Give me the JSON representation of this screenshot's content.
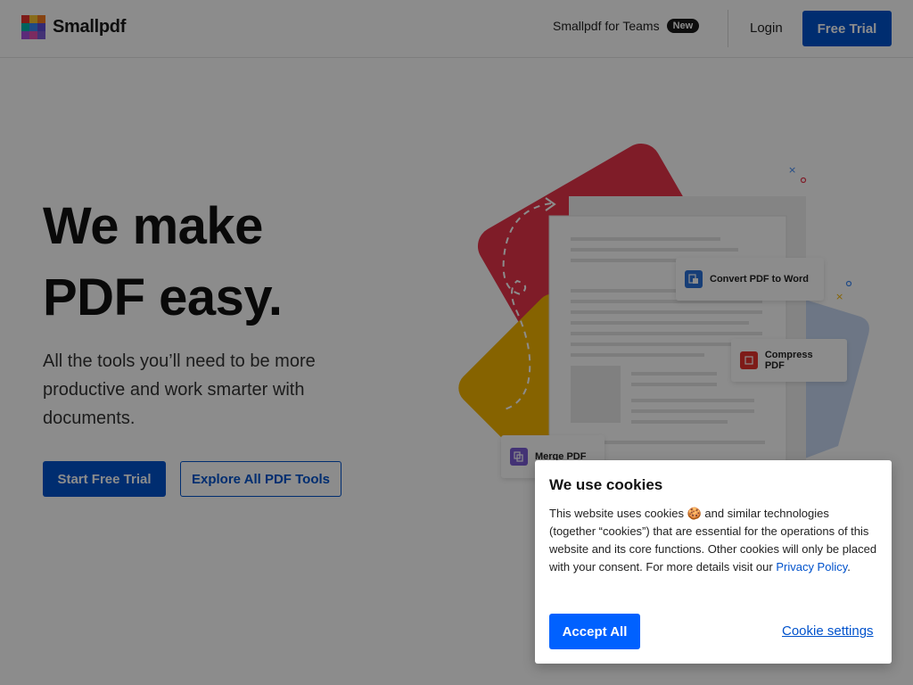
{
  "header": {
    "brand": "Smallpdf",
    "logo_colors": [
      "#e5322d",
      "#f7c331",
      "#f47b20",
      "#00b2a9",
      "#3a87f5",
      "#5f4bd3",
      "#a64fdc",
      "#e04fb0",
      "#7b5cd6"
    ],
    "teams_label": "Smallpdf for Teams",
    "new_badge": "New",
    "login_label": "Login",
    "free_trial_label": "Free Trial"
  },
  "hero": {
    "title_line1": "We make",
    "title_line2": "PDF easy.",
    "subtitle": "All the tools you’ll need to be more productive and work smarter with documents.",
    "start_trial_label": "Start Free Trial",
    "explore_label": "Explore All PDF Tools"
  },
  "illustration": {
    "convert_label": "Convert PDF to Word",
    "compress_label": "Compress PDF",
    "merge_label": "Merge PDF",
    "colors": {
      "red": "#e8334a",
      "yellow": "#f5b400",
      "light_blue": "#c7d8f2",
      "word_blue": "#2b72d9",
      "compress_red": "#e5322d",
      "merge_purple": "#7b5cd6"
    }
  },
  "cookie": {
    "title": "We use cookies",
    "body_part1": "This website uses cookies 🍪 and similar technologies (together “cookies”) that are essential for the operations of this website and its core functions. Other cookies will only be placed with your consent. For more details visit our ",
    "privacy_link": "Privacy Policy",
    "body_part2": ".",
    "accept_label": "Accept All",
    "settings_label": "Cookie settings"
  },
  "brand_colors": {
    "primary": "#0052cc",
    "accept": "#0061ff"
  }
}
